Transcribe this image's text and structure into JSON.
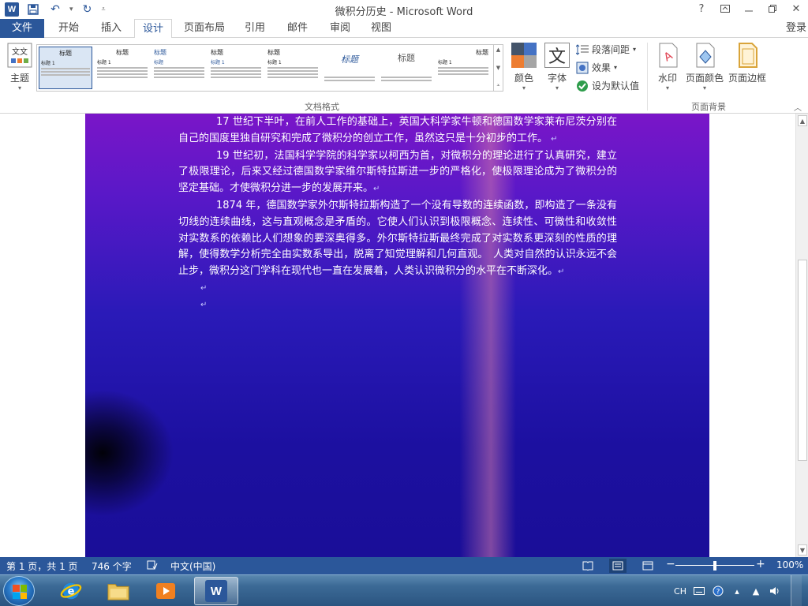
{
  "titlebar": {
    "title": "微积分历史 - Microsoft Word",
    "app_icon_letter": "W",
    "help": "?"
  },
  "tabs": [
    {
      "label": "文件"
    },
    {
      "label": "开始"
    },
    {
      "label": "插入"
    },
    {
      "label": "设计"
    },
    {
      "label": "页面布局"
    },
    {
      "label": "引用"
    },
    {
      "label": "邮件"
    },
    {
      "label": "审阅"
    },
    {
      "label": "视图"
    }
  ],
  "login_label": "登录",
  "ribbon": {
    "theme_label": "主题",
    "styles_gallery": [
      {
        "title": "标题",
        "heading": "标题 1"
      },
      {
        "title": "标题",
        "heading": "标题 1"
      },
      {
        "title": "标题",
        "heading": "标题"
      },
      {
        "title": "标题",
        "heading": "标题 1"
      },
      {
        "title": "标题",
        "heading": "标题 1"
      },
      {
        "title": "标题",
        "heading": ""
      },
      {
        "title": "标题",
        "heading": ""
      },
      {
        "title": "标题",
        "heading": "标题 1"
      }
    ],
    "colors_label": "颜色",
    "fonts_label": "字体",
    "fonts_glyph": "文",
    "paragraph_spacing_label": "段落间距",
    "effects_label": "效果",
    "set_default_label": "设为默认值",
    "document_formatting_group": "文档格式",
    "watermark_label": "水印",
    "page_color_label": "页面颜色",
    "page_borders_label": "页面边框",
    "page_background_group": "页面背景"
  },
  "document": {
    "paragraphs": [
      "17 世纪下半叶，在前人工作的基础上，英国大科学家牛顿和德国数学家莱布尼茨分别在自己的国度里独自研究和完成了微积分的创立工作，虽然这只是十分初步的工作。",
      "19 世纪初，法国科学学院的科学家以柯西为首，对微积分的理论进行了认真研究，建立了极限理论，后来又经过德国数学家维尔斯特拉斯进一步的严格化，使极限理论成为了微积分的坚定基础。才使微积分进一步的发展开来。",
      "1874 年，德国数学家外尔斯特拉斯构造了一个没有导数的连续函数，即构造了一条没有切线的连续曲线，这与直观概念是矛盾的。它使人们认识到极限概念、连续性、可微性和收敛性对实数系的依赖比人们想象的要深奥得多。外尔斯特拉斯最终完成了对实数系更深刻的性质的理解，使得数学分析完全由实数系导出，脱离了知觉理解和几何直观。　人类对自然的认识永远不会止步，微积分这门学科在现代也一直在发展着，人类认识微积分的水平在不断深化。"
    ],
    "paragraph_mark": "↵",
    "colors": {
      "top": "#7a16c8",
      "bottom": "#1a0e98",
      "text": "#ffffff"
    }
  },
  "statusbar": {
    "page_info": "第 1 页，共 1 页",
    "word_count": "746 个字",
    "language": "中文(中国)",
    "zoom": "100%",
    "zoom_minus": "−",
    "zoom_plus": "+"
  },
  "taskbar": {
    "tray_lang": "CH",
    "apps": [
      "internet-explorer",
      "file-explorer",
      "media-player",
      "word"
    ]
  }
}
